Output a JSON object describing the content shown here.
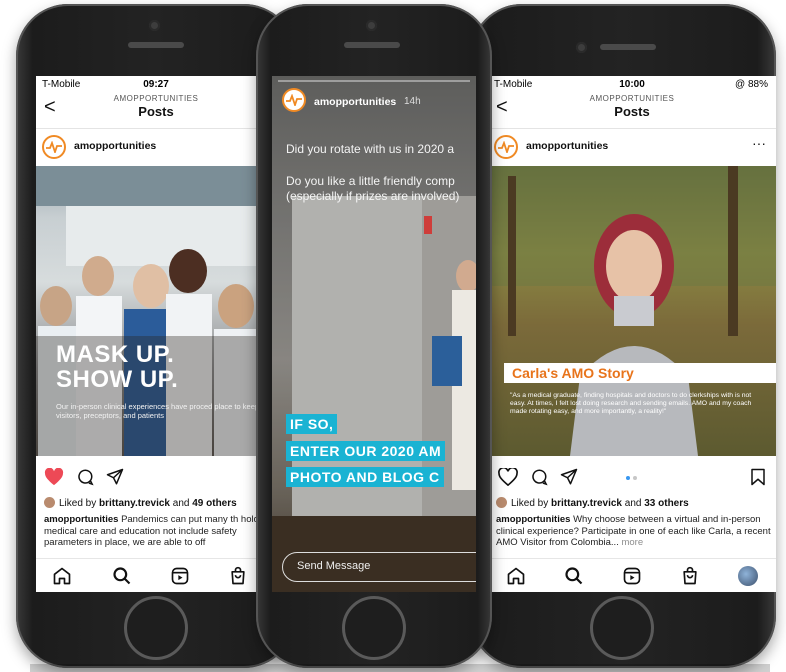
{
  "phone1": {
    "status": {
      "carrier": "T-Mobile",
      "time": "09:27",
      "right": ""
    },
    "header": {
      "account_caps": "AMOPPORTUNITIES",
      "title": "Posts",
      "back": "<"
    },
    "account": {
      "name": "amopportunities"
    },
    "photo": {
      "title_line1": "MASK UP.",
      "title_line2": "SHOW UP.",
      "subtitle": "Our in-person clinical experiences have proced place to keep visitors, preceptors, and patients"
    },
    "liked": {
      "prefix": "Liked by",
      "user": "brittany.trevick",
      "mid": "and",
      "others": "49 others"
    },
    "caption": {
      "user": "amopportunities",
      "text": "Pandemics can put many th hold; medical care and education not include safety parameters in place, we are able to off"
    }
  },
  "phone2": {
    "story": {
      "account": "amopportunities",
      "age": "14h"
    },
    "lines": [
      "Did you rotate with us in 2020 a",
      "Do you like a little friendly comp",
      "(especially if prizes are involved)"
    ],
    "bands": [
      "IF SO,",
      "ENTER OUR 2020 AM",
      "PHOTO AND BLOG C"
    ],
    "send_placeholder": "Send Message"
  },
  "phone3": {
    "status": {
      "carrier": "T-Mobile",
      "time": "10:00",
      "right": "@ 88%"
    },
    "header": {
      "account_caps": "AMOPPORTUNITIES",
      "title": "Posts",
      "back": "<"
    },
    "account": {
      "name": "amopportunities",
      "more": "···"
    },
    "photo": {
      "banner": "Carla's AMO Story",
      "quote": "\"As a medical graduate, finding hospitals and doctors to do clerkships with is not easy. At times, I felt lost doing research and sending emails. AMO and my coach made rotating easy, and more importantly, a reality!\""
    },
    "liked": {
      "prefix": "Liked by",
      "user": "brittany.trevick",
      "mid": "and",
      "others": "33 others"
    },
    "caption": {
      "user": "amopportunities",
      "text": "Why choose between a virtual and in-person clinical experience? Participate in one of each like Carla, a recent AMO Visitor from Colombia...",
      "more": "more"
    }
  },
  "colors": {
    "heart": "#ed4956",
    "brand_orange": "#f08a24",
    "story_band": "#1ab3d3",
    "carla_orange": "#e8741b"
  },
  "icons": [
    "heart-icon",
    "comment-icon",
    "share-icon",
    "bookmark-icon",
    "home-icon",
    "search-icon",
    "reels-icon",
    "shop-icon",
    "profile-icon"
  ]
}
